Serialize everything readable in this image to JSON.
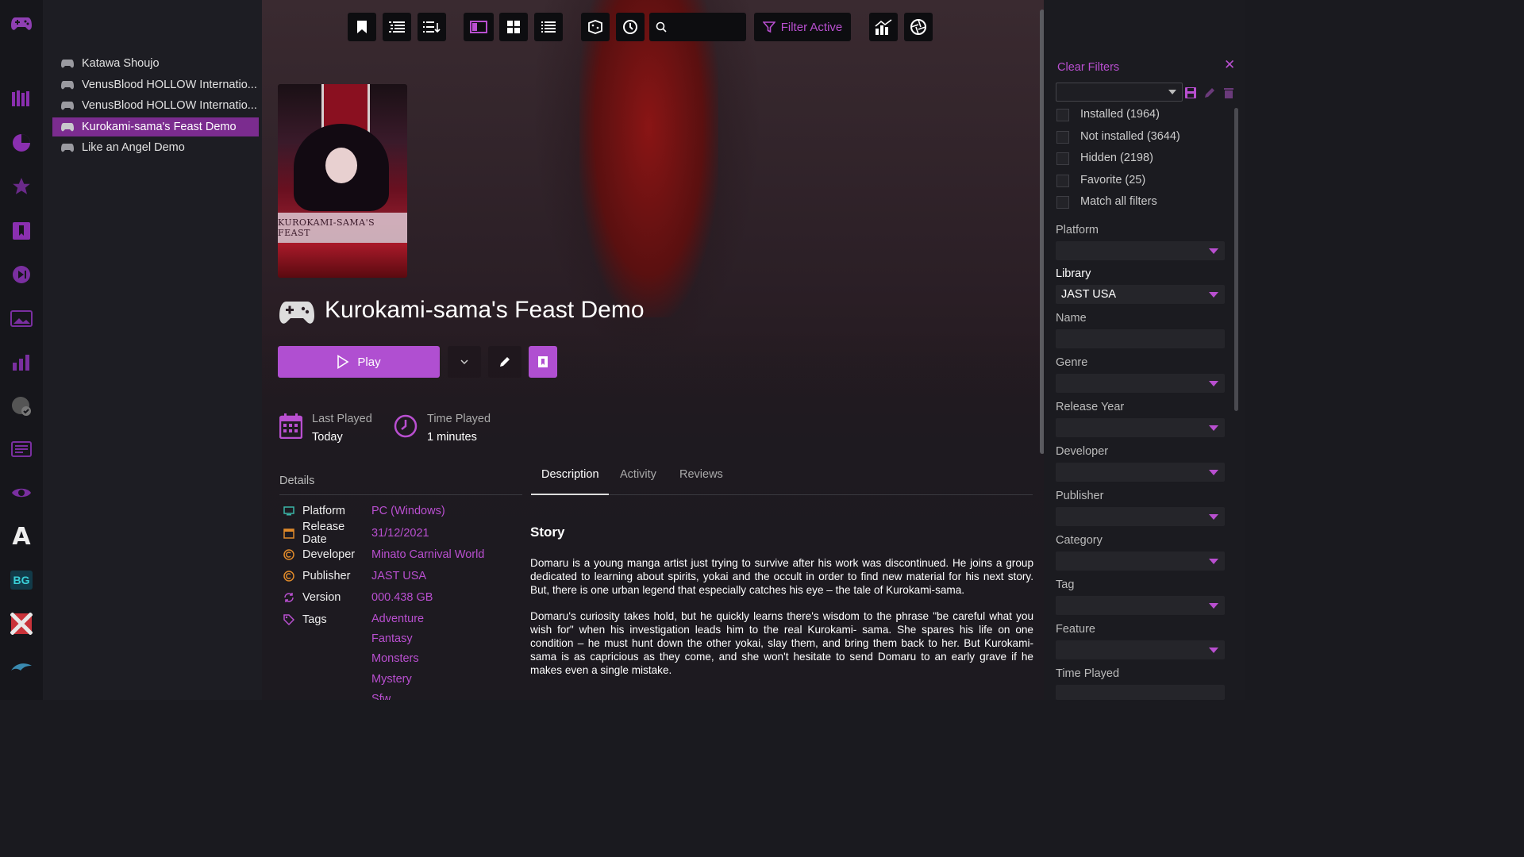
{
  "colors": {
    "accent": "#b94fd0",
    "selected": "#7b2c8f",
    "play": "#b04fd1"
  },
  "sidebar_icons": [
    "gamepad-icon",
    "library-icon",
    "pie-chart-icon",
    "star-icon",
    "bookmark-icon",
    "media-player-icon",
    "photo-icon",
    "stats-icon",
    "clock-check-icon",
    "news-icon",
    "eye-icon",
    "font-a-icon",
    "bg-icon",
    "flag-icon",
    "dolphin-icon"
  ],
  "sidebar_bg_label": "BG",
  "games": [
    {
      "name": "Katawa Shoujo"
    },
    {
      "name": "VenusBlood HOLLOW Internatio..."
    },
    {
      "name": "VenusBlood HOLLOW Internatio..."
    },
    {
      "name": "Kurokami-sama's Feast Demo"
    },
    {
      "name": "Like an Angel Demo"
    }
  ],
  "toolbar": {
    "search_placeholder": "",
    "filter_label": "Filter Active"
  },
  "window": {
    "minimize": "–",
    "restore": "🗗",
    "close": "✕"
  },
  "game": {
    "title": "Kurokami-sama's Feast Demo",
    "cover_text": "KUROKAMI-SAMA'S FEAST",
    "play_label": "Play",
    "last_played_label": "Last Played",
    "last_played_value": "Today",
    "time_played_label": "Time Played",
    "time_played_value": "1 minutes"
  },
  "details": {
    "heading": "Details",
    "platform_label": "Platform",
    "platform": "PC (Windows)",
    "release_label": "Release Date",
    "release": "31/12/2021",
    "developer_label": "Developer",
    "developer": "Minato Carnival World",
    "publisher_label": "Publisher",
    "publisher": "JAST USA",
    "version_label": "Version",
    "version": "000.438 GB",
    "tags_label": "Tags",
    "tags": [
      "Adventure",
      "Fantasy",
      "Monsters",
      "Mystery",
      "Sfw"
    ]
  },
  "tabs": {
    "description": "Description",
    "activity": "Activity",
    "reviews": "Reviews"
  },
  "story": {
    "heading": "Story",
    "p1": "Domaru is a young manga artist just trying to survive after his work was discontinued. He joins a group dedicated to learning about spirits, yokai and the occult in order to find new material for his next story. But, there is one urban legend that especially catches his eye – the tale of Kurokami-sama.",
    "p2": "Domaru's curiosity takes hold, but he quickly learns there's wisdom to the phrase \"be careful what you wish for\" when his investigation leads him to the real Kurokami- sama. She spares his life on one condition – he must hunt down the other yokai, slay them, and bring them back to her. But Kurokami- sama is as capricious as they come, and she won't hesitate to send Domaru to an early grave if he makes even a single mistake."
  },
  "filters": {
    "clear_label": "Clear Filters",
    "close": "✕",
    "checks": [
      "Installed (1964)",
      "Not installed (3644)",
      "Hidden (2198)",
      "Favorite (25)",
      "Match all filters"
    ],
    "platform_label": "Platform",
    "library_label": "Library",
    "library_value": "JAST USA",
    "name_label": "Name",
    "genre_label": "Genre",
    "release_year_label": "Release Year",
    "developer_label": "Developer",
    "publisher_label": "Publisher",
    "category_label": "Category",
    "tag_label": "Tag",
    "feature_label": "Feature",
    "time_played_label": "Time Played"
  }
}
